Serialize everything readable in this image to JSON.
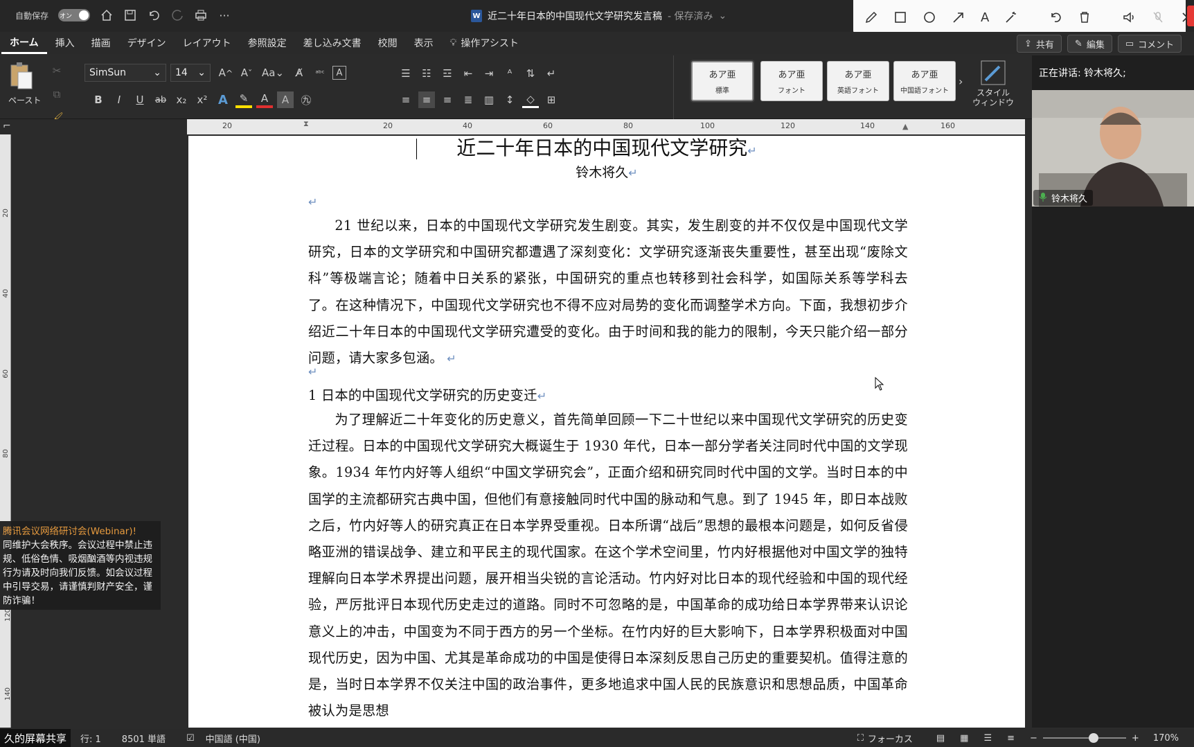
{
  "titlebar": {
    "autosave_label": "自動保存",
    "autosave_state": "オン",
    "document_title": "近二十年日本的中国现代文学研究发言稿",
    "save_status": "- 保存済み",
    "word_icon": "W"
  },
  "menu": {
    "tabs": [
      "ホーム",
      "挿入",
      "描画",
      "デザイン",
      "レイアウト",
      "参照設定",
      "差し込み文書",
      "校閲",
      "表示"
    ],
    "assist": "操作アシスト",
    "share": "共有",
    "edit": "編集",
    "comment": "コメント"
  },
  "ribbon": {
    "paste": "ペースト",
    "font_name": "SimSun",
    "font_size": "14",
    "case_btn": "Aa",
    "styles": [
      {
        "sample": "あア亜",
        "label": "標準"
      },
      {
        "sample": "あア亜",
        "label": "フォント"
      },
      {
        "sample": "あア亜",
        "label": "英語フォント"
      },
      {
        "sample": "あア亜",
        "label": "中国語フォント"
      }
    ],
    "style_window_1": "スタイル",
    "style_window_2": "ウィンドウ"
  },
  "ruler": {
    "top_ticks": [
      "20",
      "20",
      "40",
      "60",
      "80",
      "100",
      "120",
      "140",
      "160"
    ],
    "left_ticks": [
      "20",
      "40",
      "60",
      "80",
      "120",
      "140"
    ]
  },
  "document": {
    "title": "近二十年日本的中国现代文学研究",
    "author": "铃木将久",
    "para1": "21 世纪以来，日本的中国现代文学研究发生剧变。其实，发生剧变的并不仅仅是中国现代文学研究，日本的文学研究和中国研究都遭遇了深刻变化：文学研究逐渐丧失重要性，甚至出现“废除文科”等极端言论；随着中日关系的紧张，中国研究的重点也转移到社会科学，如国际关系等学科去了。在这种情况下，中国现代文学研究也不得不应对局势的变化而调整学术方向。下面，我想初步介绍近二十年日本的中国现代文学研究遭受的变化。由于时间和我的能力的限制，今天只能介绍一部分问题，请大家多包涵。",
    "heading1": "1  日本的中国现代文学研究的历史变迁",
    "para2": "为了理解近二十年变化的历史意义，首先简单回顾一下二十世纪以来中国现代文学研究的历史变迁过程。日本的中国现代文学研究大概诞生于 1930 年代，日本一部分学者关注同时代中国的文学现象。1934 年竹内好等人组织“中国文学研究会”，正面介绍和研究同时代中国的文学。当时日本的中国学的主流都研究古典中国，但他们有意接触同时代中国的脉动和气息。到了 1945 年，即日本战败之后，竹内好等人的研究真正在日本学界受重视。日本所谓“战后”思想的最根本问题是，如何反省侵略亚洲的错误战争、建立和平民主的现代国家。在这个学术空间里，竹内好根据他对中国文学的独特理解向日本学术界提出问题，展开相当尖锐的言论活动。竹内好对比日本的现代经验和中国的现代经验，严厉批评日本现代历史走过的道路。同时不可忽略的是，中国革命的成功给日本学界带来认识论意义上的冲击，中国变为不同于西方的另一个坐标。在竹内好的巨大影响下，日本学界积极面对中国现代历史，因为中国、尤其是革命成功的中国是使得日本深刻反思自己历史的重要契机。值得注意的是，当时日本学界不仅关注中国的政治事件，更多地追求中国人民的民族意识和思想品质，中国革命被认为是思想"
  },
  "meeting": {
    "speaking": "正在讲话: 铃木将久;",
    "participant": "铃木将久",
    "notice_title": "腾讯会议网络研讨会(Webinar)!",
    "notice_body": "同维护大会秩序。会议过程中禁止违规、低俗色情、吸烟酗酒等内视违规行为请及时向我们反馈。如会议过程中引导交易，请谨慎判财产安全，谨防诈骗！",
    "share_label": "久的屏幕共享"
  },
  "status": {
    "line": "行: 1",
    "words": "8501 単語",
    "language": "中国語 (中国)",
    "focus": "フォーカス",
    "zoom": "170%"
  },
  "colors": {
    "accent": "#2b579a",
    "record": "#e53935",
    "notice_title": "#f0a040",
    "paragraph_mark": "#6c8ebf"
  }
}
